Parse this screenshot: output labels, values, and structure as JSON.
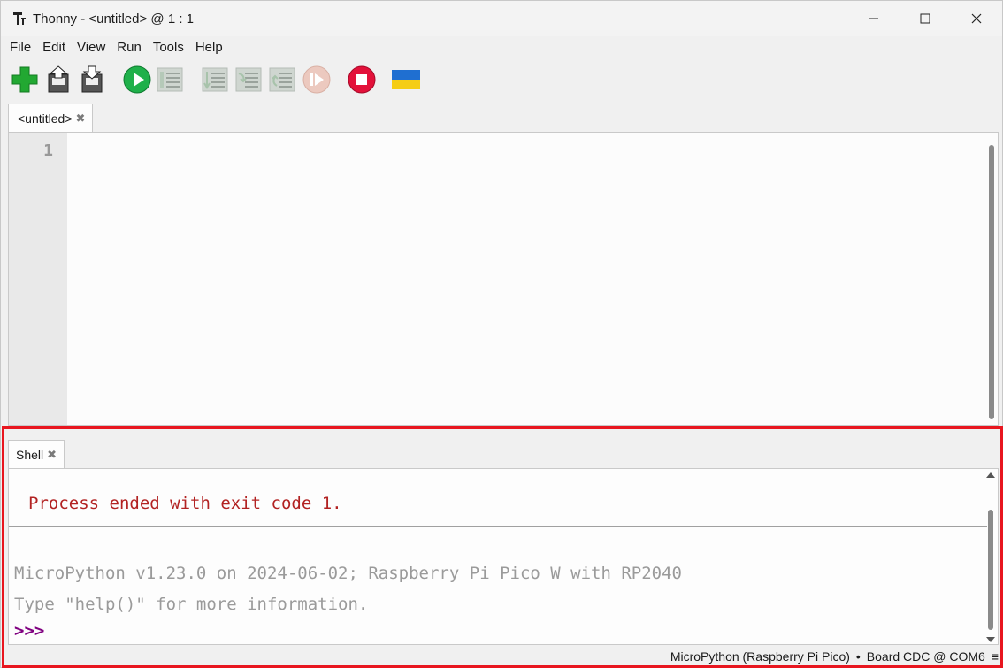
{
  "window": {
    "title": "Thonny  -  <untitled>  @  1 : 1",
    "app_icon": "thonny-logo-icon",
    "controls": [
      "minimize-icon",
      "maximize-icon",
      "close-icon"
    ]
  },
  "menu": [
    "File",
    "Edit",
    "View",
    "Run",
    "Tools",
    "Help"
  ],
  "toolbar": [
    {
      "name": "new-file",
      "icon": "plus-icon",
      "color": "#22a832"
    },
    {
      "name": "open-file",
      "icon": "open-icon"
    },
    {
      "name": "save-file",
      "icon": "save-icon"
    },
    {
      "name": "run",
      "icon": "run-icon",
      "color": "#1fb04a"
    },
    {
      "name": "debug",
      "icon": "debug-icon",
      "disabled": true
    },
    {
      "name": "step-over",
      "icon": "step-over-icon",
      "disabled": true
    },
    {
      "name": "step-into",
      "icon": "step-into-icon",
      "disabled": true
    },
    {
      "name": "step-out",
      "icon": "step-out-icon",
      "disabled": true
    },
    {
      "name": "resume",
      "icon": "resume-icon",
      "disabled": true
    },
    {
      "name": "stop",
      "icon": "stop-icon",
      "color": "#e3113a"
    },
    {
      "name": "ukraine-flag",
      "icon": "flag-icon",
      "colors": [
        "#1f6fd1",
        "#f5cd15"
      ]
    }
  ],
  "editor": {
    "tab_label": "<untitled>",
    "line_numbers": [
      "1"
    ]
  },
  "shell": {
    "tab_label": "Shell",
    "error_line": "Process ended with exit code 1.",
    "banner_line1": "MicroPython v1.23.0 on 2024-06-02; Raspberry Pi Pico W with RP2040",
    "banner_line2": "Type \"help()\" for more information.",
    "prompt": ">>>"
  },
  "statusbar": {
    "interpreter": "MicroPython (Raspberry Pi Pico)",
    "separator": "•",
    "port": "Board CDC @ COM6",
    "menu_icon": "hamburger-icon",
    "menu_glyph": "≡"
  },
  "highlight_color": "#e8161f"
}
